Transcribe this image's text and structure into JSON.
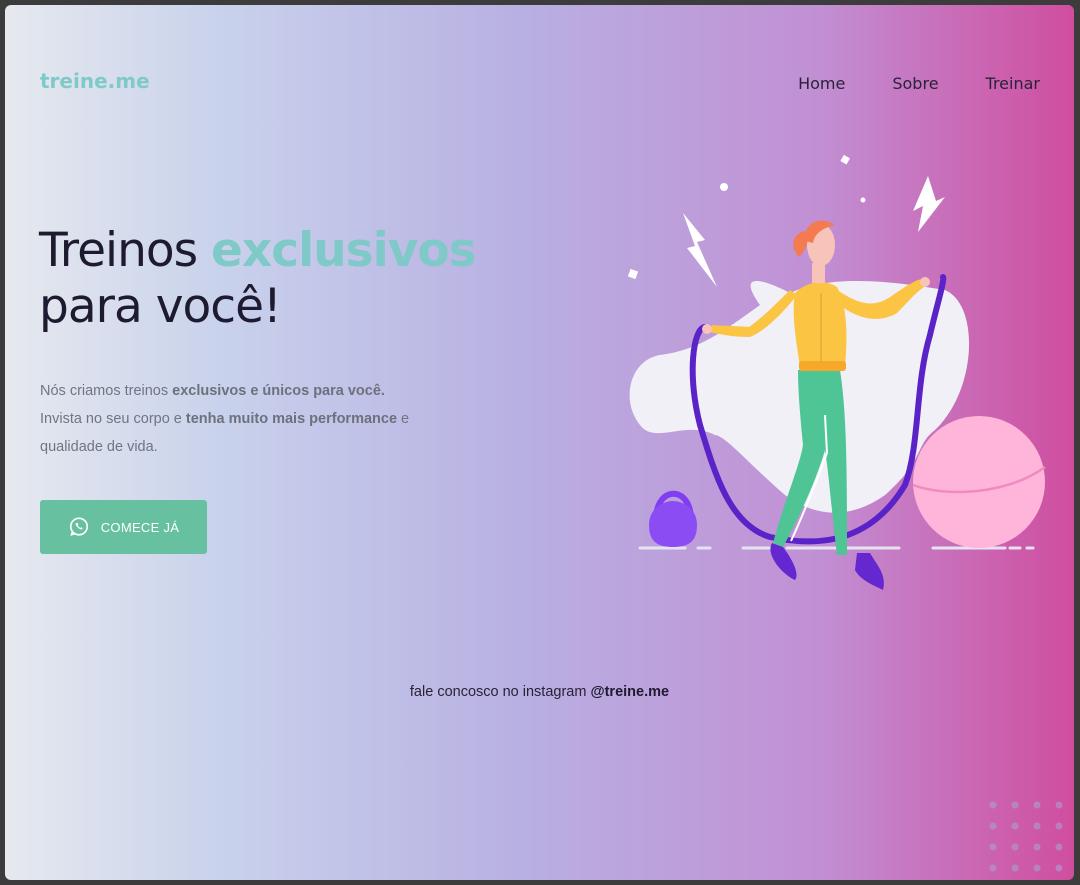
{
  "header": {
    "logo": "treine.me",
    "nav": [
      {
        "label": "Home"
      },
      {
        "label": "Sobre"
      },
      {
        "label": "Treinar"
      }
    ]
  },
  "hero": {
    "headline_part1": "Treinos ",
    "headline_accent": "exclusivos",
    "headline_part2": "para você!",
    "description": {
      "line1_plain": "Nós criamos treinos ",
      "line1_bold": "exclusivos e únicos para você.",
      "line2_plain": "Invista no seu corpo e ",
      "line2_bold": "tenha muito mais performance",
      "line2_tail": " e",
      "line3": "qualidade de vida."
    },
    "cta": {
      "label": "COMECE JÁ",
      "icon": "whatsapp-icon"
    }
  },
  "footer": {
    "instagram_text": "fale concosco no instagram ",
    "instagram_handle": "@treine.me"
  },
  "colors": {
    "accent": "#7fcac8",
    "button": "#67c1a0",
    "text_dark": "#1e1a30"
  }
}
